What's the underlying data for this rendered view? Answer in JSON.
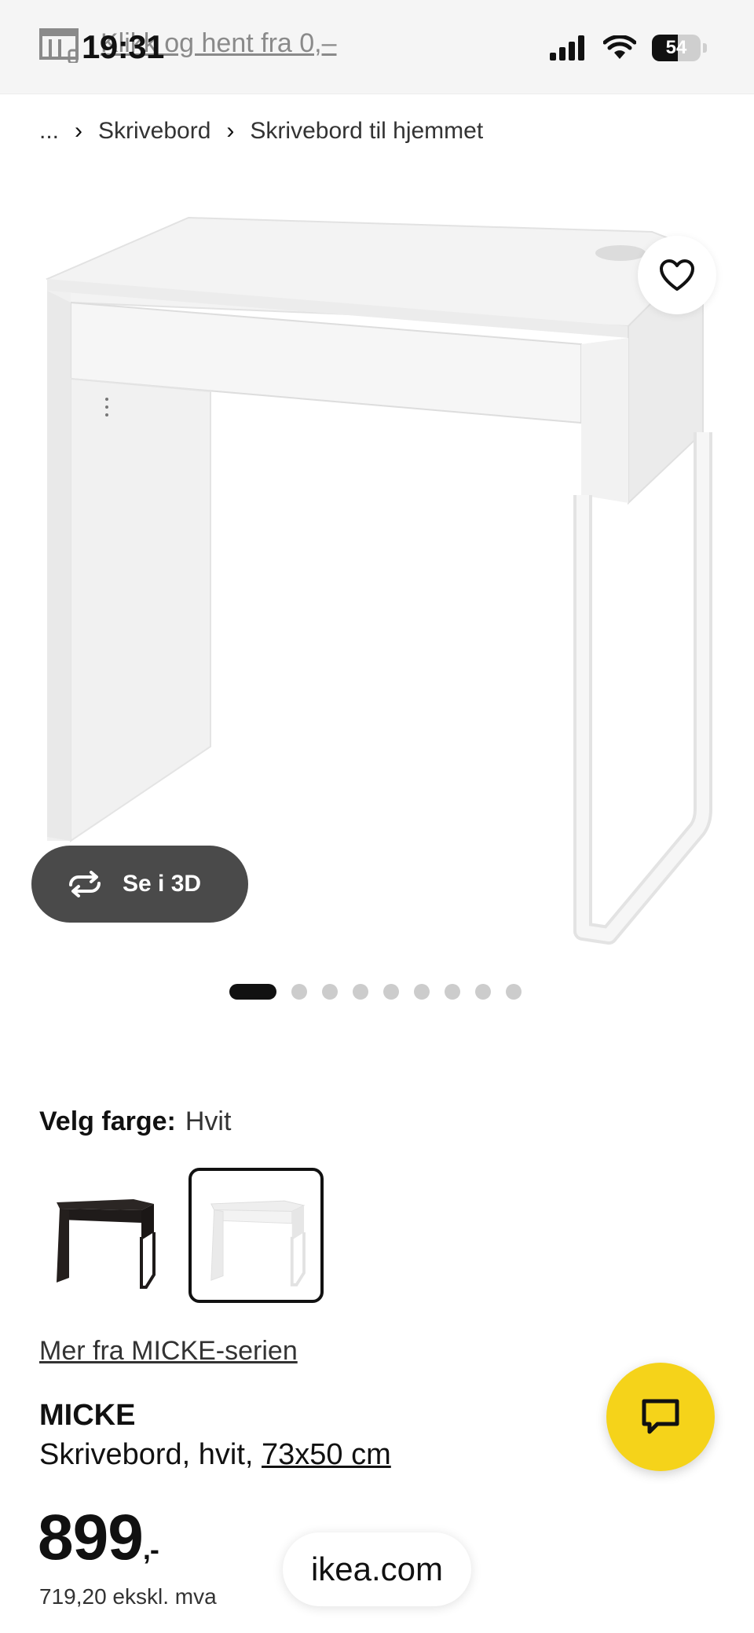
{
  "status_bar": {
    "time": "19:31",
    "battery_percent": "54",
    "battery_level": 0.54,
    "promo_text": "Klikk og hent fra 0,–",
    "icons": [
      "store-icon",
      "signal-icon",
      "wifi-icon",
      "battery-icon"
    ]
  },
  "breadcrumb": {
    "items": [
      "...",
      "Skrivebord",
      "Skrivebord til hjemmet"
    ]
  },
  "gallery": {
    "view_3d_label": "Se i 3D",
    "dot_count": 9,
    "active_index": 0
  },
  "color": {
    "label": "Velg farge:",
    "selected_value": "Hvit",
    "swatches": [
      "black-brown",
      "white"
    ]
  },
  "product": {
    "series_link": "Mer fra MICKE-serien",
    "name": "MICKE",
    "description": "Skrivebord, hvit, ",
    "dimensions": "73x50 cm",
    "price": "899",
    "price_suffix": ",-",
    "price_excl_vat": "719,20 ekskl. mva"
  },
  "browser": {
    "url": "ikea.com"
  },
  "colors": {
    "accent_yellow": "#f5d31a",
    "dark_button": "#4a4a4a"
  }
}
